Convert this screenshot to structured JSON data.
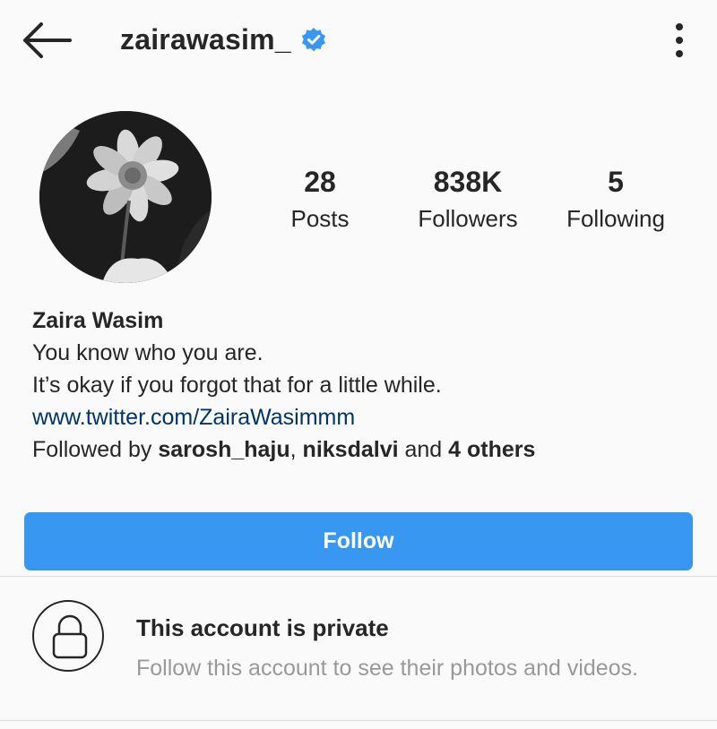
{
  "header": {
    "username": "zairawasim_",
    "verified": true,
    "icons": {
      "back": "back-arrow-icon",
      "verified": "verified-badge-icon",
      "more": "more-vertical-icon"
    }
  },
  "stats": [
    {
      "value": "28",
      "label": "Posts"
    },
    {
      "value": "838K",
      "label": "Followers"
    },
    {
      "value": "5",
      "label": "Following"
    }
  ],
  "bio": {
    "name": "Zaira Wasim",
    "line1": "You know who you are.",
    "line2": "It’s okay if you forgot that for a little while.",
    "link": "www.twitter.com/ZairaWasimmm",
    "followed_prefix": "Followed by ",
    "followed_user1": "sarosh_haju",
    "followed_sep": ", ",
    "followed_user2": "niksdalvi",
    "followed_and": " and ",
    "followed_others": "4 others"
  },
  "follow_button": {
    "label": "Follow"
  },
  "private": {
    "title": "This account is private",
    "subtitle": "Follow this account to see their photos and videos.",
    "icon": "lock-icon"
  },
  "colors": {
    "accent": "#3897f0",
    "link": "#003569",
    "muted": "#999999",
    "verified": "#3897f0"
  }
}
